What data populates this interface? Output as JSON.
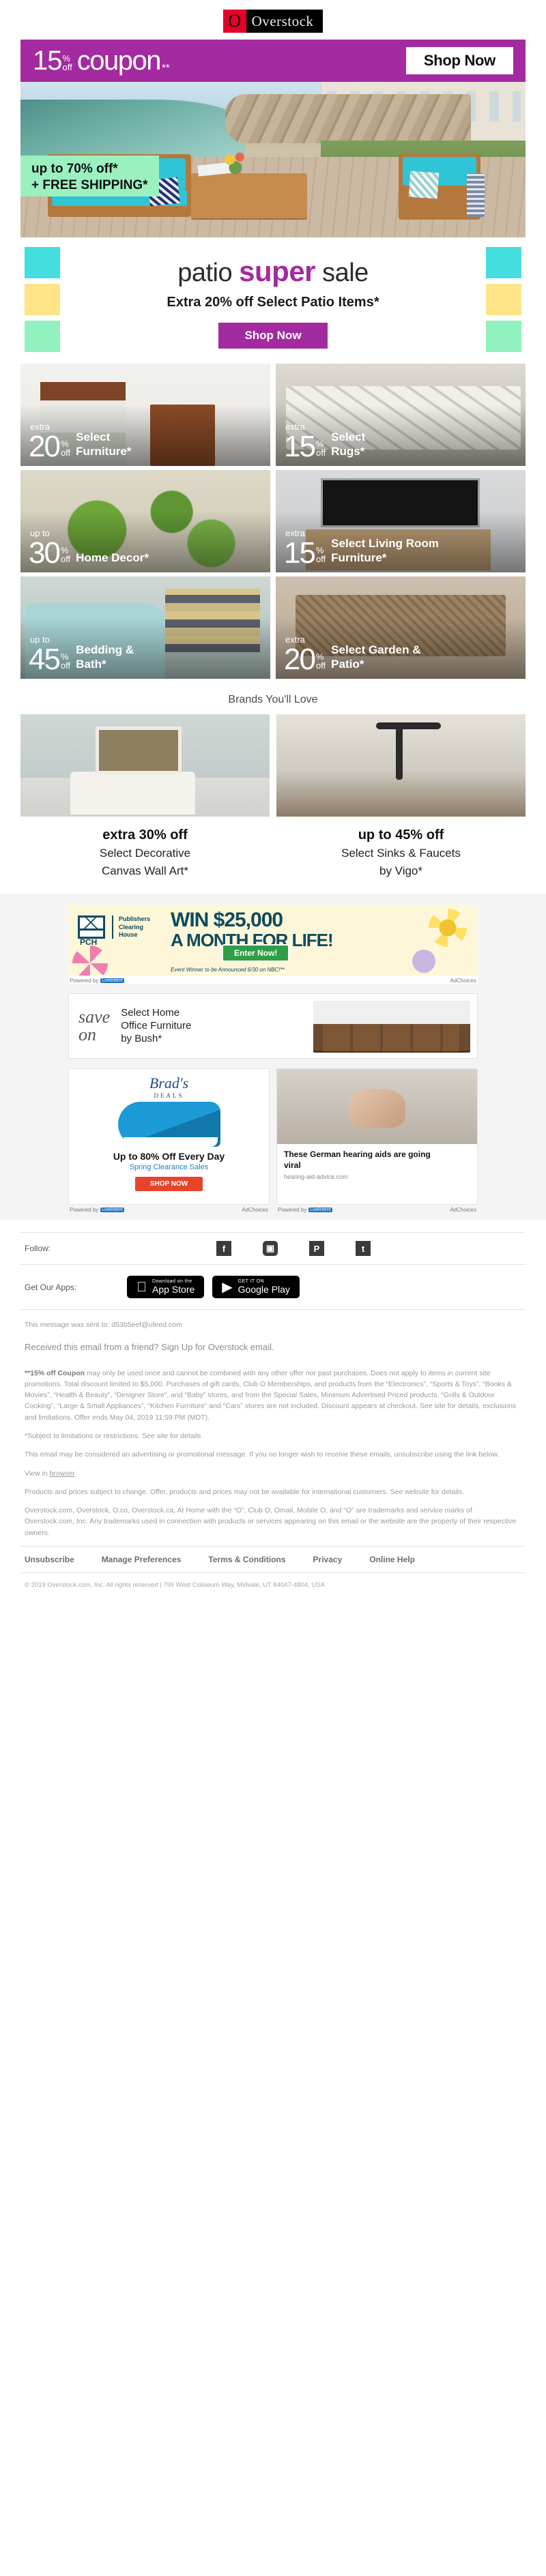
{
  "brand": {
    "logo_letter": "O",
    "logo_word": "Overstock"
  },
  "coupon": {
    "percent": "15",
    "pct_symbol": "%",
    "off": "off",
    "word": "coupon",
    "asterisks": "**",
    "cta": "Shop Now"
  },
  "hero": {
    "badge_line1": "up to 70% off*",
    "badge_line2": "+ FREE SHIPPING*"
  },
  "sale": {
    "title_part1": "patio ",
    "title_super": "super",
    "title_part2": " sale",
    "subtitle": "Extra 20% off Select Patio Items*",
    "cta": "Shop Now"
  },
  "grid": [
    {
      "prefix": "extra",
      "num": "20",
      "pct": "%",
      "off": "off",
      "label1": "Select",
      "label2": "Furniture*"
    },
    {
      "prefix": "extra",
      "num": "15",
      "pct": "%",
      "off": "off",
      "label1": "Select",
      "label2": "Rugs*"
    },
    {
      "prefix": "up to",
      "num": "30",
      "pct": "%",
      "off": "off",
      "label1": "Home Decor*",
      "label2": ""
    },
    {
      "prefix": "extra",
      "num": "15",
      "pct": "%",
      "off": "off",
      "label1": "Select Living Room",
      "label2": "Furniture*"
    },
    {
      "prefix": "up to",
      "num": "45",
      "pct": "%",
      "off": "off",
      "label1": "Bedding &",
      "label2": "Bath*"
    },
    {
      "prefix": "extra",
      "num": "20",
      "pct": "%",
      "off": "off",
      "label1": "Select Garden &",
      "label2": "Patio*"
    }
  ],
  "brands": {
    "title": "Brands You'll Love",
    "items": [
      {
        "headline": "extra 30% off",
        "sub1": "Select Decorative",
        "sub2": "Canvas Wall Art*"
      },
      {
        "headline": "up to 45% off",
        "sub1": "Select Sinks & Faucets",
        "sub2": "by Vigo*"
      }
    ]
  },
  "ads": {
    "pch": {
      "abbr": "PCH",
      "words_l1": "Publishers",
      "words_l2": "Clearing",
      "words_l3": "House",
      "headline1": "WIN $25,000",
      "headline2": "A MONTH FOR LIFE!",
      "button": "Enter Now!",
      "footnote": "Event Winner to be Announced 6/30 on NBC!**",
      "powered_by": "Powered by",
      "powered_brand": "LiveIntent",
      "adchoices": "AdChoices"
    },
    "bush": {
      "save": "save",
      "on": "on",
      "line1": "Select Home",
      "line2": "Office Furniture",
      "line3": "by Bush*"
    },
    "brads": {
      "logo": "Brad's",
      "logo_sub": "DEALS",
      "headline": "Up to 80% Off Every Day",
      "sub": "Spring Clearance Sales",
      "button": "SHOP NOW",
      "powered_by": "Powered by",
      "powered_brand": "LiveIntent",
      "adchoices": "AdChoices"
    },
    "hearing": {
      "headline1": "These German hearing aids are going",
      "headline2": "viral",
      "source": "hearing-aid-advice.com",
      "powered_by": "Powered by",
      "powered_brand": "LiveIntent",
      "adchoices": "AdChoices"
    }
  },
  "social": {
    "label": "Follow:",
    "icons": [
      {
        "name": "facebook-icon",
        "glyph": "f"
      },
      {
        "name": "instagram-icon",
        "glyph": "▣"
      },
      {
        "name": "pinterest-icon",
        "glyph": "P"
      },
      {
        "name": "twitter-icon",
        "glyph": "t"
      }
    ]
  },
  "apps": {
    "label": "Get Our Apps:",
    "apple": {
      "glyph": "",
      "small": "Download on the",
      "big": "App Store"
    },
    "google": {
      "glyph": "▶",
      "small": "GET IT ON",
      "big": "Google Play"
    }
  },
  "footer": {
    "sent_to": "This message was sent to: d53b5eef@ufeed.com",
    "friend": "Received this email from a friend?  Sign Up for Overstock email.",
    "coupon_terms_lead": "**15% off Coupon",
    "coupon_terms_body": " may only be used once and cannot be combined with any other offer nor past purchases. Does not apply to items in current site promotions. Total discount limited to $5,000. Purchases of gift cards, Club O Memberships, and products from the “Electronics”, “Sports & Toys”, “Books & Movies”, “Health & Beauty”, “Designer Store”, and “Baby” stores, and from the Special Sales, Minimum Advertised Priced products, “Grills & Outdoor Cooking”, “Large & Small Appliances”, “Kitchen Furniture” and “Cars” stores are not included. Discount appears at checkout. See site for details, exclusions and limitations. Offer ends May 04, 2019 11:59 PM (MDT).",
    "subject_to": "*Subject to limitations or restrictions. See site for details",
    "promo_note": "This email may be considered an advertising or promotional message. If you no longer wish to receive these emails, unsubscribe using the link below.",
    "view_in": "View in ",
    "view_in_link": "browser",
    "prices_note": "Products and prices subject to change. Offer, products and prices may not be available for international customers. See website for details.",
    "trademarks": "Overstock.com, Overstock, O.co, Overstock.ca, At Home with the “O”, Club O, Omail, Mobile O, and “O” are trademarks and service marks of Overstock.com, Inc. Any trademarks used in connection with products or services appearing on this email or the website are the property of their respective owners.",
    "links": [
      "Unsubscribe",
      "Manage Preferences",
      "Terms & Conditions",
      "Privacy",
      "Online Help"
    ],
    "copyright": "© 2019 Overstock.com, Inc. All rights reserved | 799 West Coliseum Way, Midvale, UT 84047-4804, USA"
  }
}
